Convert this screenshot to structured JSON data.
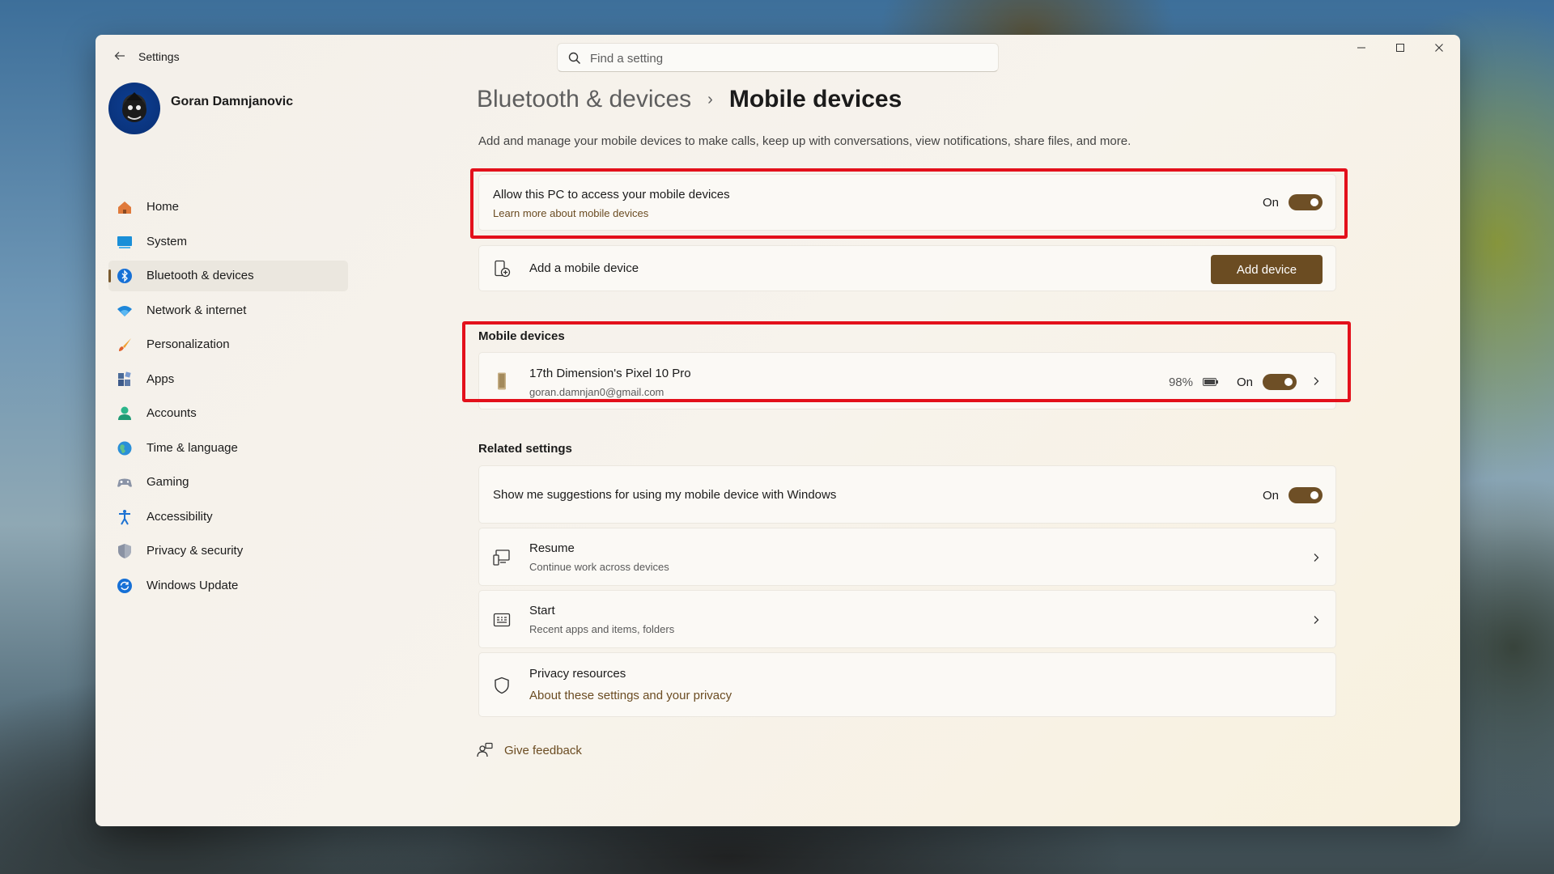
{
  "window": {
    "app_title": "Settings",
    "search_placeholder": "Find a setting"
  },
  "user": {
    "name": "Goran Damnjanovic"
  },
  "sidebar": {
    "items": [
      {
        "label": "Home",
        "icon": "home-icon"
      },
      {
        "label": "System",
        "icon": "system-icon"
      },
      {
        "label": "Bluetooth & devices",
        "icon": "bluetooth-icon",
        "selected": true
      },
      {
        "label": "Network & internet",
        "icon": "wifi-icon"
      },
      {
        "label": "Personalization",
        "icon": "brush-icon"
      },
      {
        "label": "Apps",
        "icon": "apps-icon"
      },
      {
        "label": "Accounts",
        "icon": "accounts-icon"
      },
      {
        "label": "Time & language",
        "icon": "globe-icon"
      },
      {
        "label": "Gaming",
        "icon": "gamepad-icon"
      },
      {
        "label": "Accessibility",
        "icon": "accessibility-icon"
      },
      {
        "label": "Privacy & security",
        "icon": "shield-icon"
      },
      {
        "label": "Windows Update",
        "icon": "update-icon"
      }
    ]
  },
  "breadcrumb": {
    "parent": "Bluetooth & devices",
    "separator": "›",
    "current": "Mobile devices"
  },
  "description": "Add and manage your mobile devices to make calls, keep up with conversations, view notifications, share files, and more.",
  "allow_access": {
    "title": "Allow this PC to access your mobile devices",
    "link": "Learn more about mobile devices",
    "state": "On",
    "enabled": true
  },
  "add_device": {
    "label": "Add a mobile device",
    "button": "Add device"
  },
  "mobile_devices": {
    "title": "Mobile devices",
    "devices": [
      {
        "name": "17th Dimension's  Pixel 10 Pro",
        "account": "goran.damnjan0@gmail.com",
        "battery": "98%",
        "state": "On",
        "enabled": true
      }
    ]
  },
  "related": {
    "title": "Related settings",
    "suggestions": {
      "label": "Show me suggestions for using my mobile device with Windows",
      "state": "On",
      "enabled": true
    },
    "resume": {
      "title": "Resume",
      "sub": "Continue work across devices"
    },
    "start": {
      "title": "Start",
      "sub": "Recent apps and items, folders"
    },
    "privacy": {
      "title": "Privacy resources",
      "link": "About these settings and your privacy"
    }
  },
  "feedback": {
    "label": "Give feedback"
  },
  "colors": {
    "accent": "#6b4c22",
    "highlight": "#e3101b"
  }
}
